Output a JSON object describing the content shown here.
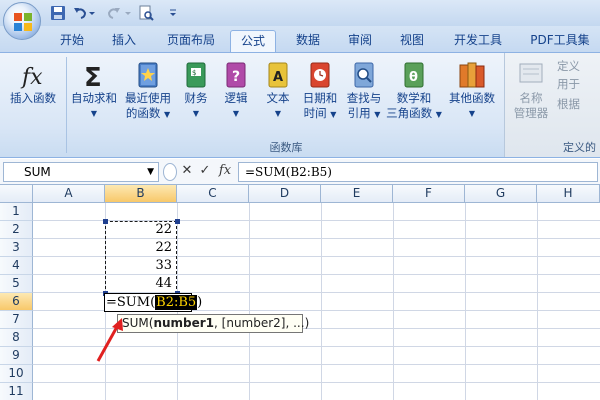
{
  "tabs": [
    "开始",
    "插入",
    "页面布局",
    "公式",
    "数据",
    "审阅",
    "视图",
    "开发工具",
    "PDF工具集"
  ],
  "ribbon": {
    "insert_function": "插入函数",
    "autosum": "自动求和",
    "recent_line1": "最近使用",
    "recent_line2": "的函数",
    "financial": "财务",
    "logical": "逻辑",
    "text": "文本",
    "datetime_line1": "日期和",
    "datetime_line2": "时间",
    "lookup_line1": "查找与",
    "lookup_line2": "引用",
    "math_line1": "数学和",
    "math_line2": "三角函数",
    "more": "其他函数",
    "group_label": "函数库",
    "name_mgr_line1": "名称",
    "name_mgr_line2": "管理器",
    "define_name": "定义",
    "use_in_formula": "用于",
    "create_from_sel": "根据",
    "defined_names_group": "定义的"
  },
  "formula_bar": {
    "name_box": "SUM",
    "cancel_symbol": "✕",
    "enter_symbol": "✓",
    "fx_symbol": "fx",
    "formula": "=SUM(B2:B5)"
  },
  "grid": {
    "columns": [
      "A",
      "B",
      "C",
      "D",
      "E",
      "F",
      "G",
      "H"
    ],
    "rows": [
      "1",
      "2",
      "3",
      "4",
      "5",
      "6",
      "7",
      "8",
      "9",
      "10",
      "11"
    ],
    "b_values": [
      "22",
      "22",
      "33",
      "44"
    ],
    "edit_prefix": "=SUM(",
    "edit_ref": "B2:B5",
    "edit_suffix": ")",
    "tooltip_fn": "SUM(",
    "tooltip_arg1": "number1",
    "tooltip_rest": ", [number2], ...)"
  },
  "colors": {
    "accent": "#15428b",
    "ribbon_bg": "#d9e6f6",
    "selected_header": "#f8c86a",
    "arrow": "#e02020"
  },
  "icons": [
    "office-logo-icon",
    "save-icon",
    "undo-icon",
    "redo-icon",
    "print-preview-icon",
    "customize-qat-icon"
  ]
}
